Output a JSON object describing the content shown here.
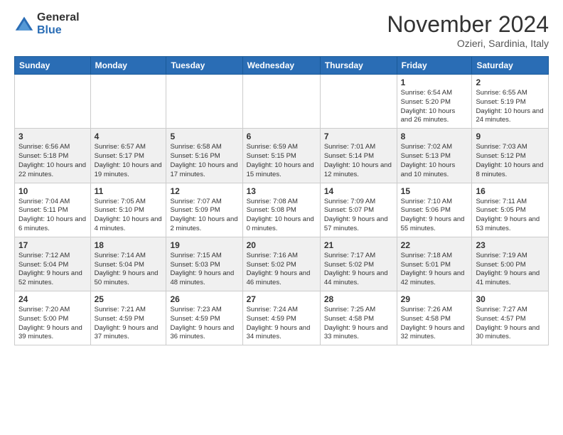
{
  "header": {
    "logo_general": "General",
    "logo_blue": "Blue",
    "month_title": "November 2024",
    "location": "Ozieri, Sardinia, Italy"
  },
  "weekdays": [
    "Sunday",
    "Monday",
    "Tuesday",
    "Wednesday",
    "Thursday",
    "Friday",
    "Saturday"
  ],
  "weeks": [
    [
      {
        "day": "",
        "info": ""
      },
      {
        "day": "",
        "info": ""
      },
      {
        "day": "",
        "info": ""
      },
      {
        "day": "",
        "info": ""
      },
      {
        "day": "",
        "info": ""
      },
      {
        "day": "1",
        "info": "Sunrise: 6:54 AM\nSunset: 5:20 PM\nDaylight: 10 hours and 26 minutes."
      },
      {
        "day": "2",
        "info": "Sunrise: 6:55 AM\nSunset: 5:19 PM\nDaylight: 10 hours and 24 minutes."
      }
    ],
    [
      {
        "day": "3",
        "info": "Sunrise: 6:56 AM\nSunset: 5:18 PM\nDaylight: 10 hours and 22 minutes."
      },
      {
        "day": "4",
        "info": "Sunrise: 6:57 AM\nSunset: 5:17 PM\nDaylight: 10 hours and 19 minutes."
      },
      {
        "day": "5",
        "info": "Sunrise: 6:58 AM\nSunset: 5:16 PM\nDaylight: 10 hours and 17 minutes."
      },
      {
        "day": "6",
        "info": "Sunrise: 6:59 AM\nSunset: 5:15 PM\nDaylight: 10 hours and 15 minutes."
      },
      {
        "day": "7",
        "info": "Sunrise: 7:01 AM\nSunset: 5:14 PM\nDaylight: 10 hours and 12 minutes."
      },
      {
        "day": "8",
        "info": "Sunrise: 7:02 AM\nSunset: 5:13 PM\nDaylight: 10 hours and 10 minutes."
      },
      {
        "day": "9",
        "info": "Sunrise: 7:03 AM\nSunset: 5:12 PM\nDaylight: 10 hours and 8 minutes."
      }
    ],
    [
      {
        "day": "10",
        "info": "Sunrise: 7:04 AM\nSunset: 5:11 PM\nDaylight: 10 hours and 6 minutes."
      },
      {
        "day": "11",
        "info": "Sunrise: 7:05 AM\nSunset: 5:10 PM\nDaylight: 10 hours and 4 minutes."
      },
      {
        "day": "12",
        "info": "Sunrise: 7:07 AM\nSunset: 5:09 PM\nDaylight: 10 hours and 2 minutes."
      },
      {
        "day": "13",
        "info": "Sunrise: 7:08 AM\nSunset: 5:08 PM\nDaylight: 10 hours and 0 minutes."
      },
      {
        "day": "14",
        "info": "Sunrise: 7:09 AM\nSunset: 5:07 PM\nDaylight: 9 hours and 57 minutes."
      },
      {
        "day": "15",
        "info": "Sunrise: 7:10 AM\nSunset: 5:06 PM\nDaylight: 9 hours and 55 minutes."
      },
      {
        "day": "16",
        "info": "Sunrise: 7:11 AM\nSunset: 5:05 PM\nDaylight: 9 hours and 53 minutes."
      }
    ],
    [
      {
        "day": "17",
        "info": "Sunrise: 7:12 AM\nSunset: 5:04 PM\nDaylight: 9 hours and 52 minutes."
      },
      {
        "day": "18",
        "info": "Sunrise: 7:14 AM\nSunset: 5:04 PM\nDaylight: 9 hours and 50 minutes."
      },
      {
        "day": "19",
        "info": "Sunrise: 7:15 AM\nSunset: 5:03 PM\nDaylight: 9 hours and 48 minutes."
      },
      {
        "day": "20",
        "info": "Sunrise: 7:16 AM\nSunset: 5:02 PM\nDaylight: 9 hours and 46 minutes."
      },
      {
        "day": "21",
        "info": "Sunrise: 7:17 AM\nSunset: 5:02 PM\nDaylight: 9 hours and 44 minutes."
      },
      {
        "day": "22",
        "info": "Sunrise: 7:18 AM\nSunset: 5:01 PM\nDaylight: 9 hours and 42 minutes."
      },
      {
        "day": "23",
        "info": "Sunrise: 7:19 AM\nSunset: 5:00 PM\nDaylight: 9 hours and 41 minutes."
      }
    ],
    [
      {
        "day": "24",
        "info": "Sunrise: 7:20 AM\nSunset: 5:00 PM\nDaylight: 9 hours and 39 minutes."
      },
      {
        "day": "25",
        "info": "Sunrise: 7:21 AM\nSunset: 4:59 PM\nDaylight: 9 hours and 37 minutes."
      },
      {
        "day": "26",
        "info": "Sunrise: 7:23 AM\nSunset: 4:59 PM\nDaylight: 9 hours and 36 minutes."
      },
      {
        "day": "27",
        "info": "Sunrise: 7:24 AM\nSunset: 4:59 PM\nDaylight: 9 hours and 34 minutes."
      },
      {
        "day": "28",
        "info": "Sunrise: 7:25 AM\nSunset: 4:58 PM\nDaylight: 9 hours and 33 minutes."
      },
      {
        "day": "29",
        "info": "Sunrise: 7:26 AM\nSunset: 4:58 PM\nDaylight: 9 hours and 32 minutes."
      },
      {
        "day": "30",
        "info": "Sunrise: 7:27 AM\nSunset: 4:57 PM\nDaylight: 9 hours and 30 minutes."
      }
    ]
  ]
}
